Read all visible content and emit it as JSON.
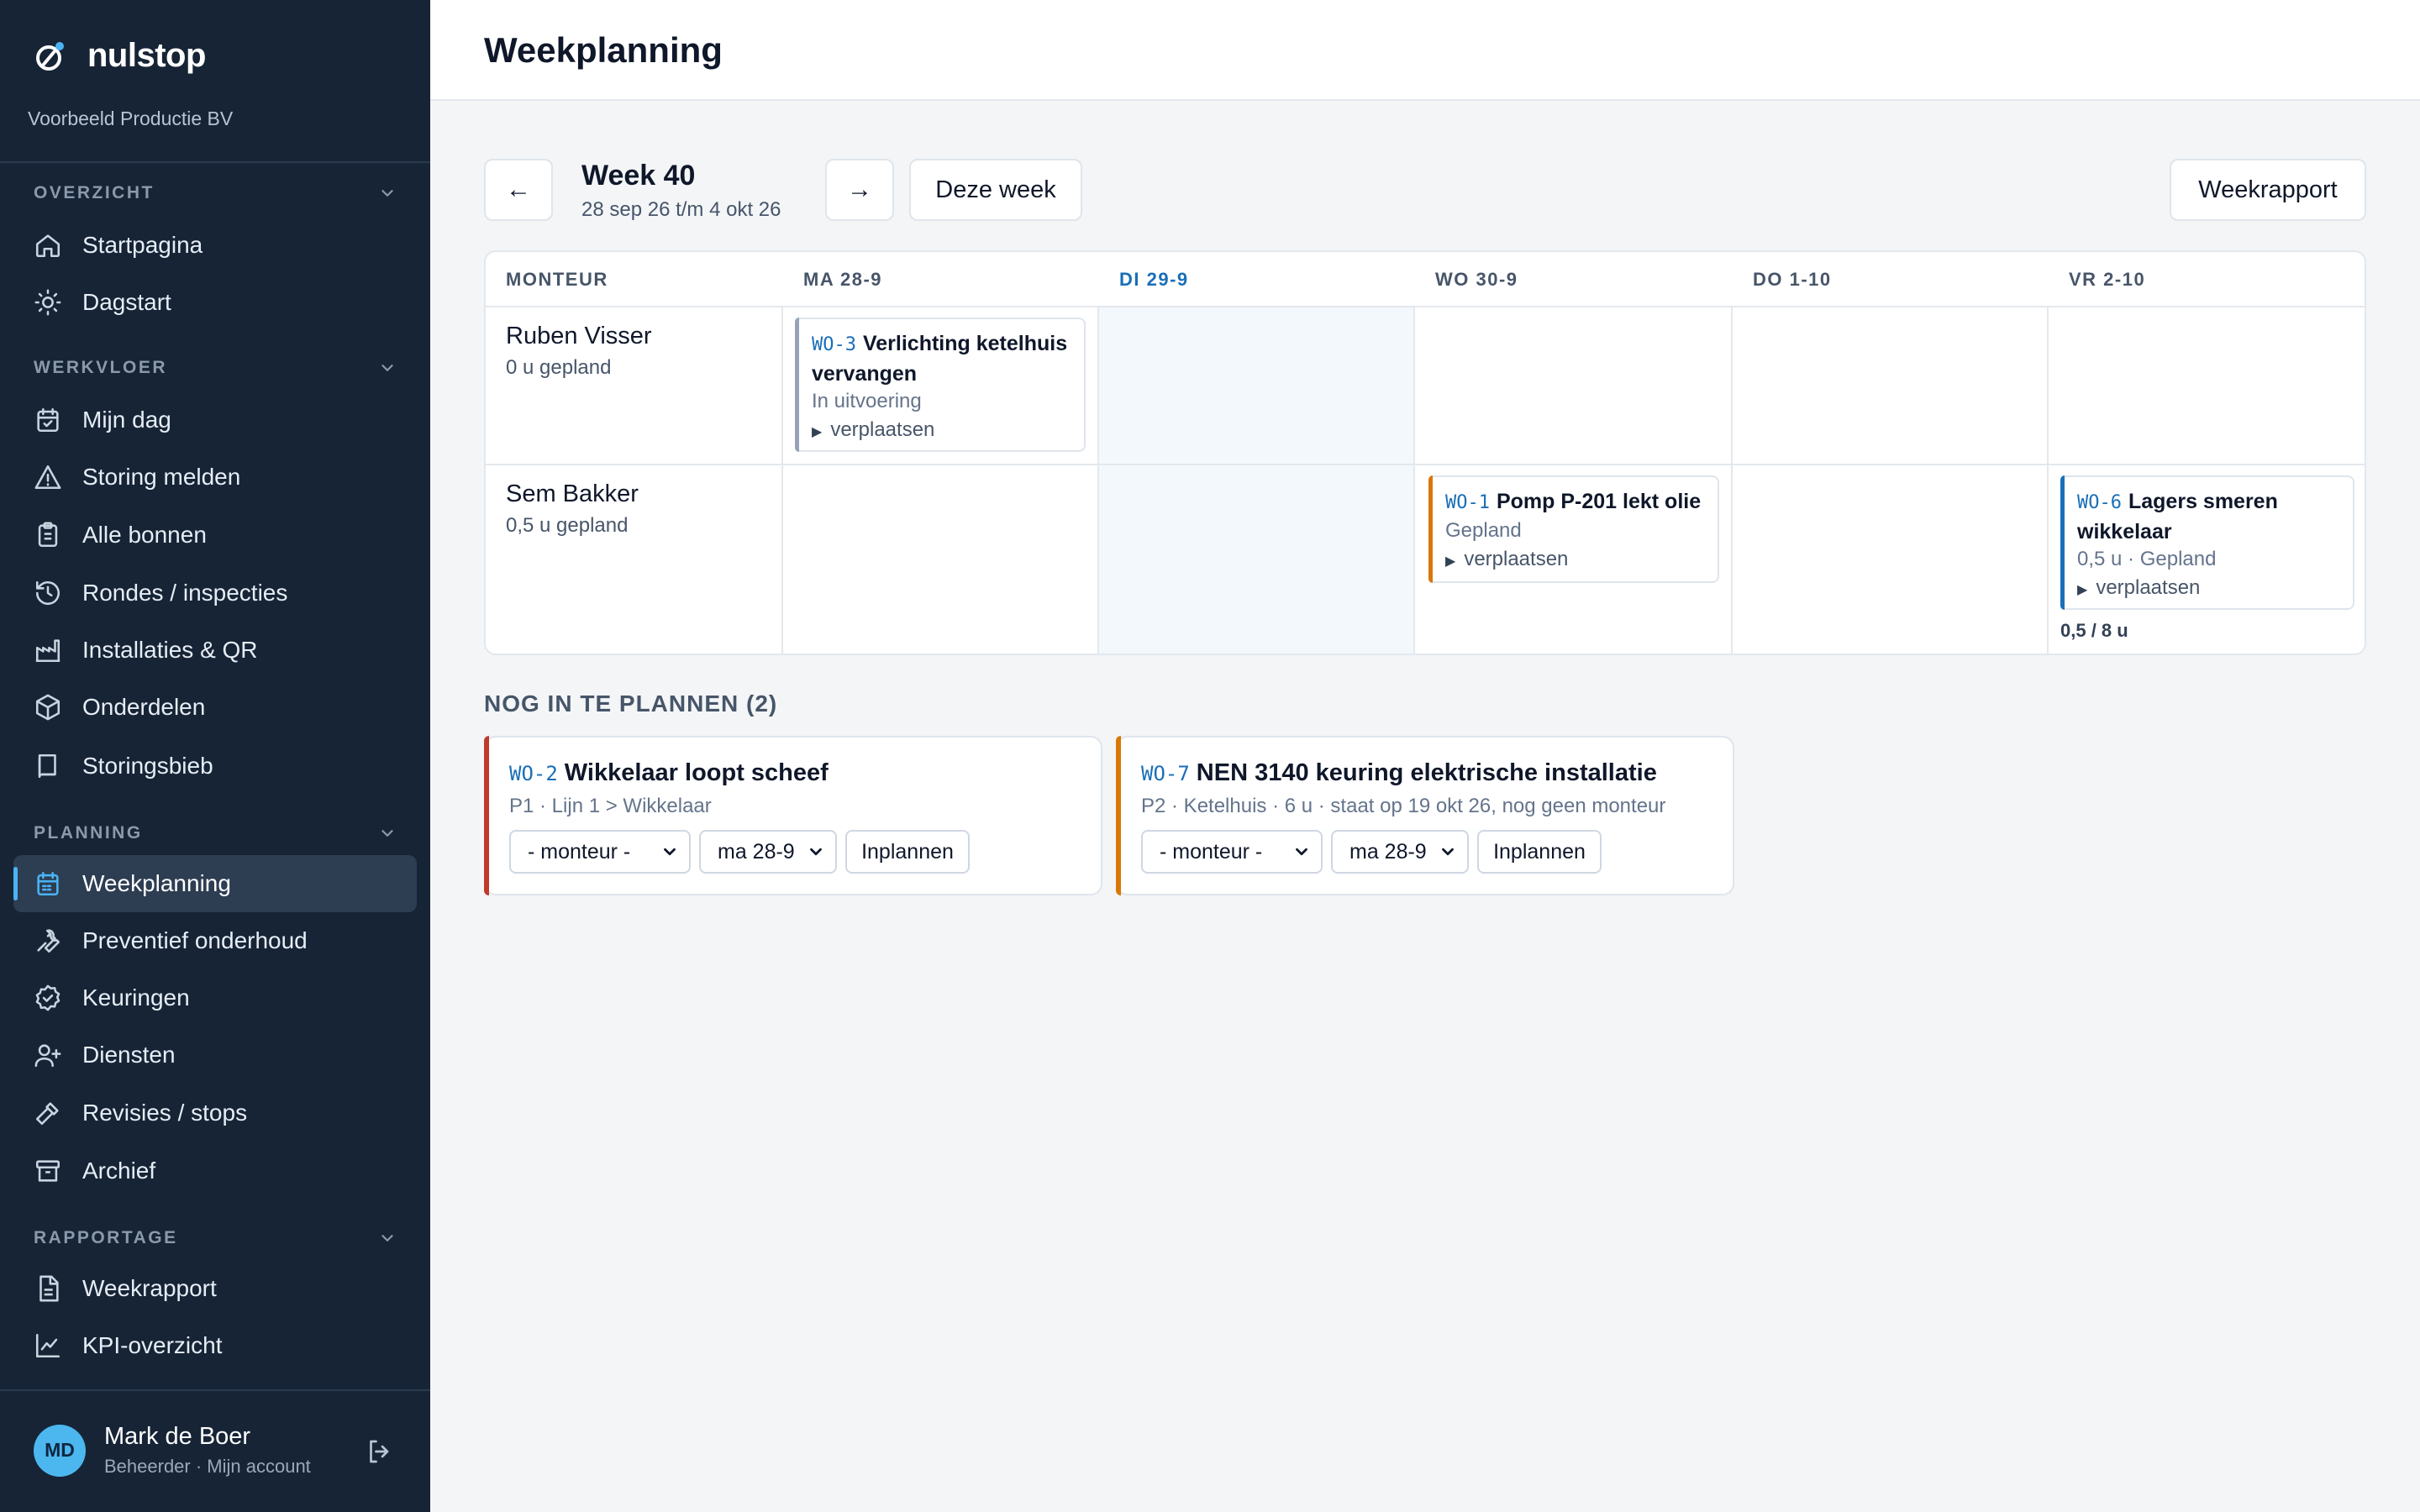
{
  "sidebar": {
    "brand": "nulstop",
    "org": "Voorbeeld Productie BV",
    "sections": [
      {
        "title": "OVERZICHT",
        "items": [
          {
            "label": "Startpagina",
            "icon": "home-icon"
          },
          {
            "label": "Dagstart",
            "icon": "sun-icon"
          }
        ]
      },
      {
        "title": "WERKVLOER",
        "items": [
          {
            "label": "Mijn dag",
            "icon": "calendar-check-icon"
          },
          {
            "label": "Storing melden",
            "icon": "warning-icon"
          },
          {
            "label": "Alle bonnen",
            "icon": "clipboard-icon"
          },
          {
            "label": "Rondes / inspecties",
            "icon": "history-icon"
          },
          {
            "label": "Installaties & QR",
            "icon": "factory-icon"
          },
          {
            "label": "Onderdelen",
            "icon": "box-icon"
          },
          {
            "label": "Storingsbieb",
            "icon": "book-icon"
          }
        ]
      },
      {
        "title": "PLANNING",
        "items": [
          {
            "label": "Weekplanning",
            "icon": "calendar-icon",
            "active": true
          },
          {
            "label": "Preventief onderhoud",
            "icon": "wrench-icon"
          },
          {
            "label": "Keuringen",
            "icon": "badge-check-icon"
          },
          {
            "label": "Diensten",
            "icon": "user-plus-icon"
          },
          {
            "label": "Revisies / stops",
            "icon": "hammer-icon"
          },
          {
            "label": "Archief",
            "icon": "archive-icon"
          }
        ]
      },
      {
        "title": "RAPPORTAGE",
        "items": [
          {
            "label": "Weekrapport",
            "icon": "file-icon"
          },
          {
            "label": "KPI-overzicht",
            "icon": "line-chart-icon"
          }
        ]
      }
    ],
    "user": {
      "initials": "MD",
      "name": "Mark de Boer",
      "sub": "Beheerder · Mijn account"
    }
  },
  "header": {
    "title": "Weekplanning"
  },
  "toolbar": {
    "prev": "←",
    "next": "→",
    "week_title": "Week 40",
    "week_range": "28 sep 26 t/m 4 okt 26",
    "this_week": "Deze week",
    "report": "Weekrapport"
  },
  "grid": {
    "columns": [
      "MONTEUR",
      "MA 28-9",
      "DI 29-9",
      "WO 30-9",
      "DO 1-10",
      "VR 2-10"
    ],
    "today_index": 2,
    "rows": [
      {
        "name": "Ruben Visser",
        "hours": "0 u gepland"
      },
      {
        "name": "Sem Bakker",
        "hours": "0,5 u gepland"
      }
    ],
    "cards": [
      {
        "code": "WO-3",
        "title": "Verlichting ketelhuis vervangen",
        "status": "In uitvoering",
        "move": "verplaatsen",
        "accent": "#94a3b8"
      },
      {
        "code": "WO-1",
        "title": "Pomp P-201 lekt olie",
        "status": "Gepland",
        "move": "verplaatsen",
        "accent": "#d97706"
      },
      {
        "code": "WO-6",
        "title": "Lagers smeren wikkelaar",
        "status": "0,5 u · Gepland",
        "move": "verplaatsen",
        "accent": "#1a6fb8"
      }
    ],
    "capacity": "0,5 / 8 u"
  },
  "unplanned": {
    "title": "NOG IN TE PLANNEN (2)",
    "cards": [
      {
        "code": "WO-2",
        "title": "Wikkelaar loopt scheef",
        "meta": "P1 · Lijn 1 > Wikkelaar",
        "monteur": "- monteur -",
        "day": "ma 28-9",
        "button": "Inplannen",
        "accent": "#c0392b"
      },
      {
        "code": "WO-7",
        "title": "NEN 3140 keuring elektrische installatie",
        "meta": "P2 · Ketelhuis · 6 u · staat op 19 okt 26, nog geen monteur",
        "monteur": "- monteur -",
        "day": "ma 28-9",
        "button": "Inplannen",
        "accent": "#d97706"
      }
    ]
  }
}
